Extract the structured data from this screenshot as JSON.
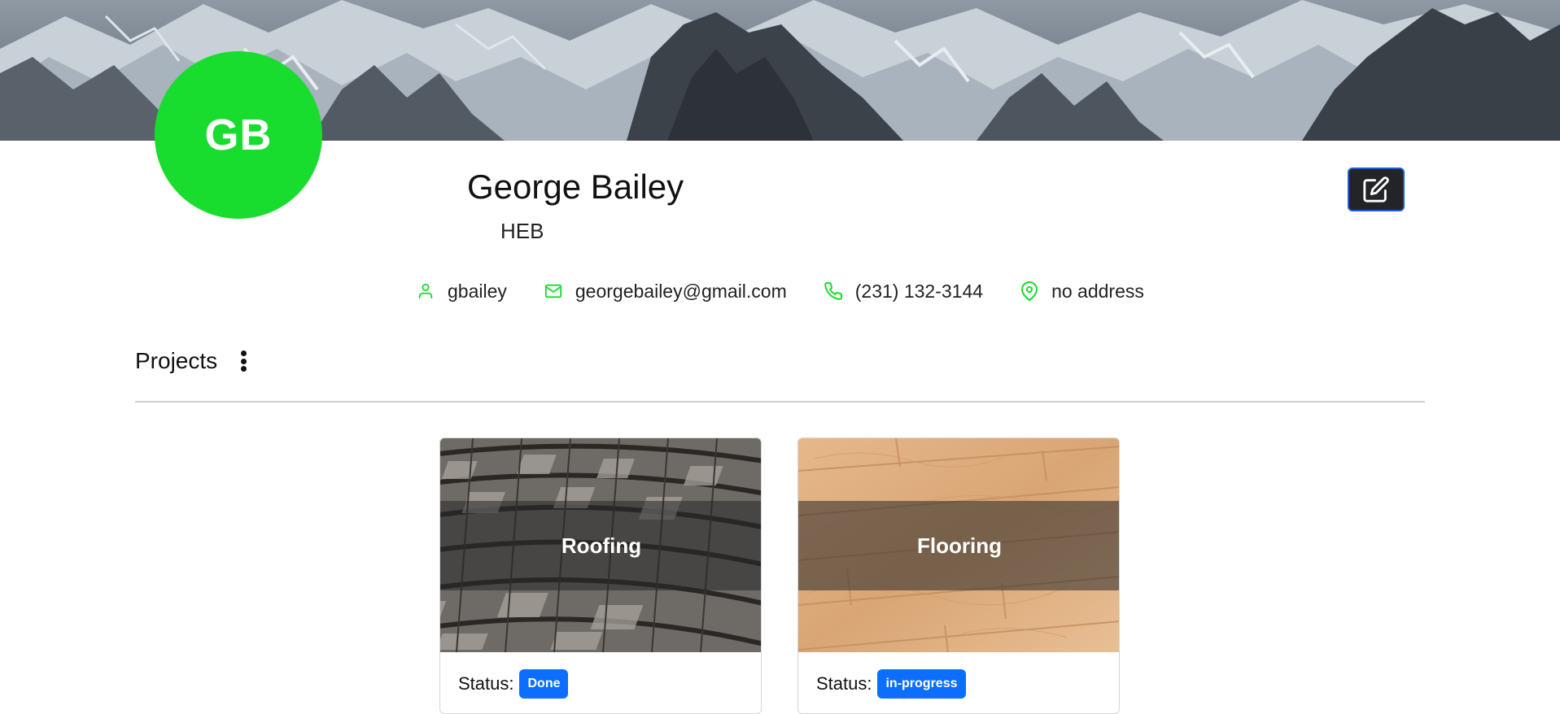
{
  "theme": {
    "accent_green": "#18dc2e",
    "badge_blue": "#0d6efd",
    "edit_button_bg": "#222428"
  },
  "profile": {
    "initials": "GB",
    "name": "George Bailey",
    "company": "HEB",
    "cover_image": "snowy-mountains",
    "edit_icon": "edit-icon"
  },
  "contact": {
    "username": "gbailey",
    "username_icon": "user-icon",
    "email": "georgebailey@gmail.com",
    "email_icon": "mail-icon",
    "phone": "(231) 132-3144",
    "phone_icon": "phone-icon",
    "address": "no address",
    "address_icon": "map-pin-icon"
  },
  "projects": {
    "title": "Projects",
    "menu_icon": "kebab-menu-icon",
    "items": [
      {
        "title": "Roofing",
        "image": "wood-shingle-roof",
        "status_label": "Status:",
        "status": "Done"
      },
      {
        "title": "Flooring",
        "image": "hardwood-floor",
        "status_label": "Status:",
        "status": "in-progress"
      }
    ]
  }
}
